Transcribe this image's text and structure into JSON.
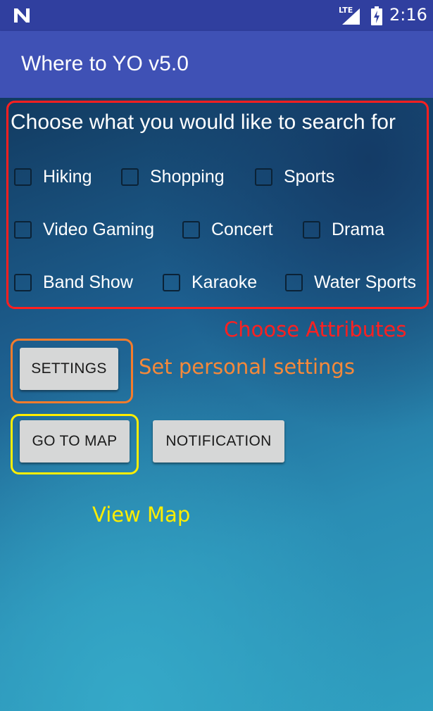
{
  "status_bar": {
    "notification_icon": "n-logo-icon",
    "network_label": "LTE",
    "signal_icon": "signal-icon",
    "battery_icon": "battery-charging-icon",
    "time": "2:16"
  },
  "app_bar": {
    "title": "Where to YO v5.0",
    "color": "#3f51b5"
  },
  "search": {
    "prompt": "Choose what you would like to search for",
    "options": [
      {
        "label": "Hiking",
        "checked": false
      },
      {
        "label": "Shopping",
        "checked": false
      },
      {
        "label": "Sports",
        "checked": false
      },
      {
        "label": "Video Gaming",
        "checked": false
      },
      {
        "label": "Concert",
        "checked": false
      },
      {
        "label": "Drama",
        "checked": false
      },
      {
        "label": "Band Show",
        "checked": false
      },
      {
        "label": "Karaoke",
        "checked": false
      },
      {
        "label": "Water Sports",
        "checked": false
      }
    ]
  },
  "annotations": {
    "attributes": "Choose Attributes",
    "settings": "Set personal settings",
    "map": "View Map",
    "colors": {
      "attributes": "#ff2020",
      "settings": "#f5893a",
      "map": "#ffee00"
    }
  },
  "buttons": {
    "settings": "SETTINGS",
    "go_to_map": "GO TO MAP",
    "notification": "NOTIFICATION"
  }
}
